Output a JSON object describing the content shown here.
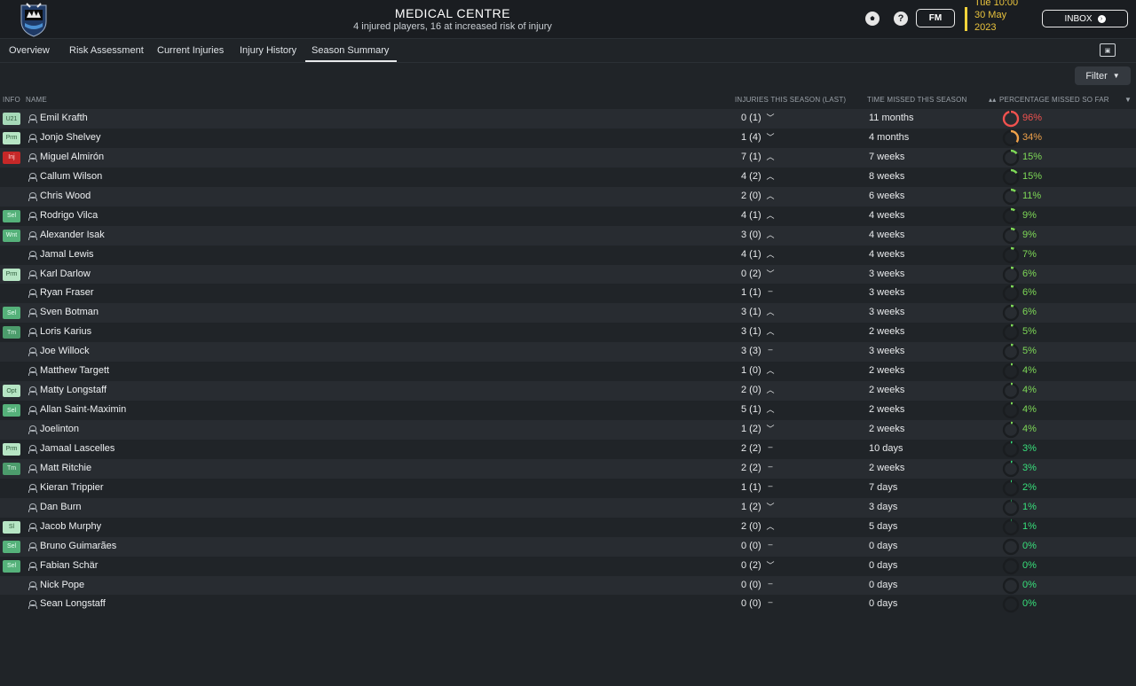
{
  "header": {
    "title": "MEDICAL CENTRE",
    "subtitle": "4 injured players, 16 at increased risk of injury",
    "help_label": "?",
    "fm_label": "FM",
    "date_line1": "Tue 10:00",
    "date_line2": "30 May",
    "date_line3": "2023",
    "inbox_label": "INBOX"
  },
  "tabs": [
    {
      "label": "Overview"
    },
    {
      "label": "Risk Assessment"
    },
    {
      "label": "Current Injuries"
    },
    {
      "label": "Injury History"
    },
    {
      "label": "Season Summary",
      "active": true
    }
  ],
  "filter_label": "Filter",
  "columns": {
    "info": "INFO",
    "name": "NAME",
    "injuries": "INJURIES THIS SEASON (LAST)",
    "time": "TIME MISSED THIS SEASON",
    "percentage": "PERCENTAGE MISSED SO FAR"
  },
  "colors": {
    "red": "#f0524f",
    "orange": "#f0a24a",
    "green": "#7ed957",
    "bright_green": "#38e07b",
    "header_bg": "#1a1d21",
    "row_odd": "#282c31",
    "row_even": "#202428",
    "date_accent": "#e8c23d"
  },
  "rows": [
    {
      "badge": "U21",
      "badge_class": "b-u21",
      "name": "Emil Krafth",
      "injuries": "0 (1)",
      "trend": "down",
      "time": "11 months",
      "pct": "96%",
      "pct_value": 96,
      "color": "#f0524f"
    },
    {
      "badge": "Prm",
      "badge_class": "b-light",
      "name": "Jonjo Shelvey",
      "injuries": "1 (4)",
      "trend": "down",
      "time": "4 months",
      "pct": "34%",
      "pct_value": 34,
      "color": "#f0a24a"
    },
    {
      "badge": "Inj",
      "badge_class": "b-inj",
      "name": "Miguel Almirón",
      "injuries": "7 (1)",
      "trend": "up",
      "time": "7 weeks",
      "pct": "15%",
      "pct_value": 15,
      "color": "#7ed957"
    },
    {
      "badge": "",
      "badge_class": "",
      "name": "Callum Wilson",
      "injuries": "4 (2)",
      "trend": "up",
      "time": "8 weeks",
      "pct": "15%",
      "pct_value": 15,
      "color": "#7ed957"
    },
    {
      "badge": "",
      "badge_class": "",
      "name": "Chris Wood",
      "injuries": "2 (0)",
      "trend": "up",
      "time": "6 weeks",
      "pct": "11%",
      "pct_value": 11,
      "color": "#7ed957"
    },
    {
      "badge": "Sel",
      "badge_class": "b-sel",
      "name": "Rodrigo Vilca",
      "injuries": "4 (1)",
      "trend": "up",
      "time": "4 weeks",
      "pct": "9%",
      "pct_value": 9,
      "color": "#7ed957"
    },
    {
      "badge": "Wnt",
      "badge_class": "b-wnt",
      "name": "Alexander Isak",
      "injuries": "3 (0)",
      "trend": "up",
      "time": "4 weeks",
      "pct": "9%",
      "pct_value": 9,
      "color": "#7ed957"
    },
    {
      "badge": "",
      "badge_class": "",
      "name": "Jamal Lewis",
      "injuries": "4 (1)",
      "trend": "up",
      "time": "4 weeks",
      "pct": "7%",
      "pct_value": 7,
      "color": "#7ed957"
    },
    {
      "badge": "Prm",
      "badge_class": "b-light",
      "name": "Karl Darlow",
      "injuries": "0 (2)",
      "trend": "down",
      "time": "3 weeks",
      "pct": "6%",
      "pct_value": 6,
      "color": "#7ed957"
    },
    {
      "badge": "",
      "badge_class": "",
      "name": "Ryan Fraser",
      "injuries": "1 (1)",
      "trend": "same",
      "time": "3 weeks",
      "pct": "6%",
      "pct_value": 6,
      "color": "#7ed957"
    },
    {
      "badge": "Sel",
      "badge_class": "b-sel",
      "name": "Sven Botman",
      "injuries": "3 (1)",
      "trend": "up",
      "time": "3 weeks",
      "pct": "6%",
      "pct_value": 6,
      "color": "#7ed957"
    },
    {
      "badge": "Tm",
      "badge_class": "b-tm",
      "name": "Loris Karius",
      "injuries": "3 (1)",
      "trend": "up",
      "time": "2 weeks",
      "pct": "5%",
      "pct_value": 5,
      "color": "#7ed957"
    },
    {
      "badge": "",
      "badge_class": "",
      "name": "Joe Willock",
      "injuries": "3 (3)",
      "trend": "same",
      "time": "3 weeks",
      "pct": "5%",
      "pct_value": 5,
      "color": "#7ed957"
    },
    {
      "badge": "",
      "badge_class": "",
      "name": "Matthew Targett",
      "injuries": "1 (0)",
      "trend": "up",
      "time": "2 weeks",
      "pct": "4%",
      "pct_value": 4,
      "color": "#7ed957"
    },
    {
      "badge": "Opt",
      "badge_class": "b-light",
      "name": "Matty Longstaff",
      "injuries": "2 (0)",
      "trend": "up",
      "time": "2 weeks",
      "pct": "4%",
      "pct_value": 4,
      "color": "#7ed957"
    },
    {
      "badge": "Sel",
      "badge_class": "b-sel",
      "name": "Allan Saint-Maximin",
      "injuries": "5 (1)",
      "trend": "up",
      "time": "2 weeks",
      "pct": "4%",
      "pct_value": 4,
      "color": "#7ed957"
    },
    {
      "badge": "",
      "badge_class": "",
      "name": "Joelinton",
      "injuries": "1 (2)",
      "trend": "down",
      "time": "2 weeks",
      "pct": "4%",
      "pct_value": 4,
      "color": "#7ed957"
    },
    {
      "badge": "Prm",
      "badge_class": "b-light",
      "name": "Jamaal Lascelles",
      "injuries": "2 (2)",
      "trend": "same",
      "time": "10 days",
      "pct": "3%",
      "pct_value": 3,
      "color": "#38e07b"
    },
    {
      "badge": "Tm",
      "badge_class": "b-tm",
      "name": "Matt Ritchie",
      "injuries": "2 (2)",
      "trend": "same",
      "time": "2 weeks",
      "pct": "3%",
      "pct_value": 3,
      "color": "#38e07b"
    },
    {
      "badge": "",
      "badge_class": "",
      "name": "Kieran Trippier",
      "injuries": "1 (1)",
      "trend": "same",
      "time": "7 days",
      "pct": "2%",
      "pct_value": 2,
      "color": "#38e07b"
    },
    {
      "badge": "",
      "badge_class": "",
      "name": "Dan Burn",
      "injuries": "1 (2)",
      "trend": "down",
      "time": "3 days",
      "pct": "1%",
      "pct_value": 1,
      "color": "#38e07b"
    },
    {
      "badge": "Sl",
      "badge_class": "b-light",
      "name": "Jacob Murphy",
      "injuries": "2 (0)",
      "trend": "up",
      "time": "5 days",
      "pct": "1%",
      "pct_value": 1,
      "color": "#38e07b"
    },
    {
      "badge": "Sel",
      "badge_class": "b-sel",
      "name": "Bruno Guimarães",
      "injuries": "0 (0)",
      "trend": "same",
      "time": "0 days",
      "pct": "0%",
      "pct_value": 0,
      "color": "#38e07b"
    },
    {
      "badge": "Sel",
      "badge_class": "b-sel",
      "name": "Fabian Schär",
      "injuries": "0 (2)",
      "trend": "down",
      "time": "0 days",
      "pct": "0%",
      "pct_value": 0,
      "color": "#38e07b"
    },
    {
      "badge": "",
      "badge_class": "",
      "name": "Nick Pope",
      "injuries": "0 (0)",
      "trend": "same",
      "time": "0 days",
      "pct": "0%",
      "pct_value": 0,
      "color": "#38e07b"
    },
    {
      "badge": "",
      "badge_class": "",
      "name": "Sean Longstaff",
      "injuries": "0 (0)",
      "trend": "same",
      "time": "0 days",
      "pct": "0%",
      "pct_value": 0,
      "color": "#38e07b"
    }
  ]
}
